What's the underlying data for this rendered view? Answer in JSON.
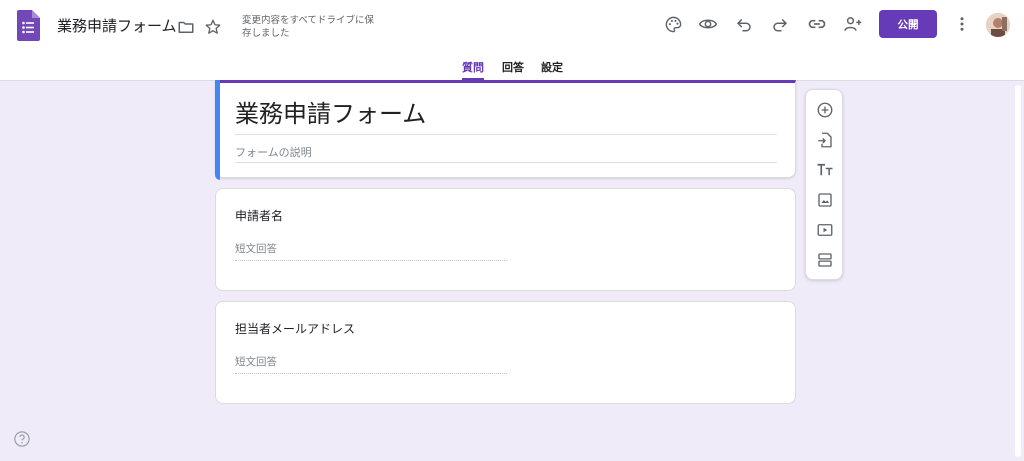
{
  "header": {
    "title": "業務申請フォーム",
    "save_status": "変更内容をすべてドライブに保存しました",
    "publish_label": "公開"
  },
  "tabs": [
    {
      "label": "質問",
      "active": true
    },
    {
      "label": "回答",
      "active": false
    },
    {
      "label": "設定",
      "active": false
    }
  ],
  "form": {
    "title": "業務申請フォーム",
    "description_placeholder": "フォームの説明"
  },
  "questions": [
    {
      "label": "申請者名",
      "answer_placeholder": "短文回答"
    },
    {
      "label": "担当者メールアドレス",
      "answer_placeholder": "短文回答"
    }
  ],
  "icons": {
    "header": [
      "folder-icon",
      "star-icon",
      "palette-icon",
      "preview-eye-icon",
      "undo-icon",
      "redo-icon",
      "link-icon",
      "add-collaborator-icon",
      "more-vert-icon"
    ],
    "toolbar": [
      "add-question-icon",
      "import-questions-icon",
      "add-title-icon",
      "add-image-icon",
      "add-video-icon",
      "add-section-icon"
    ],
    "help": "help-icon"
  },
  "colors": {
    "accent": "#673ab7",
    "title_card_left_bar": "#4285f4",
    "background": "#f0ebf8"
  }
}
